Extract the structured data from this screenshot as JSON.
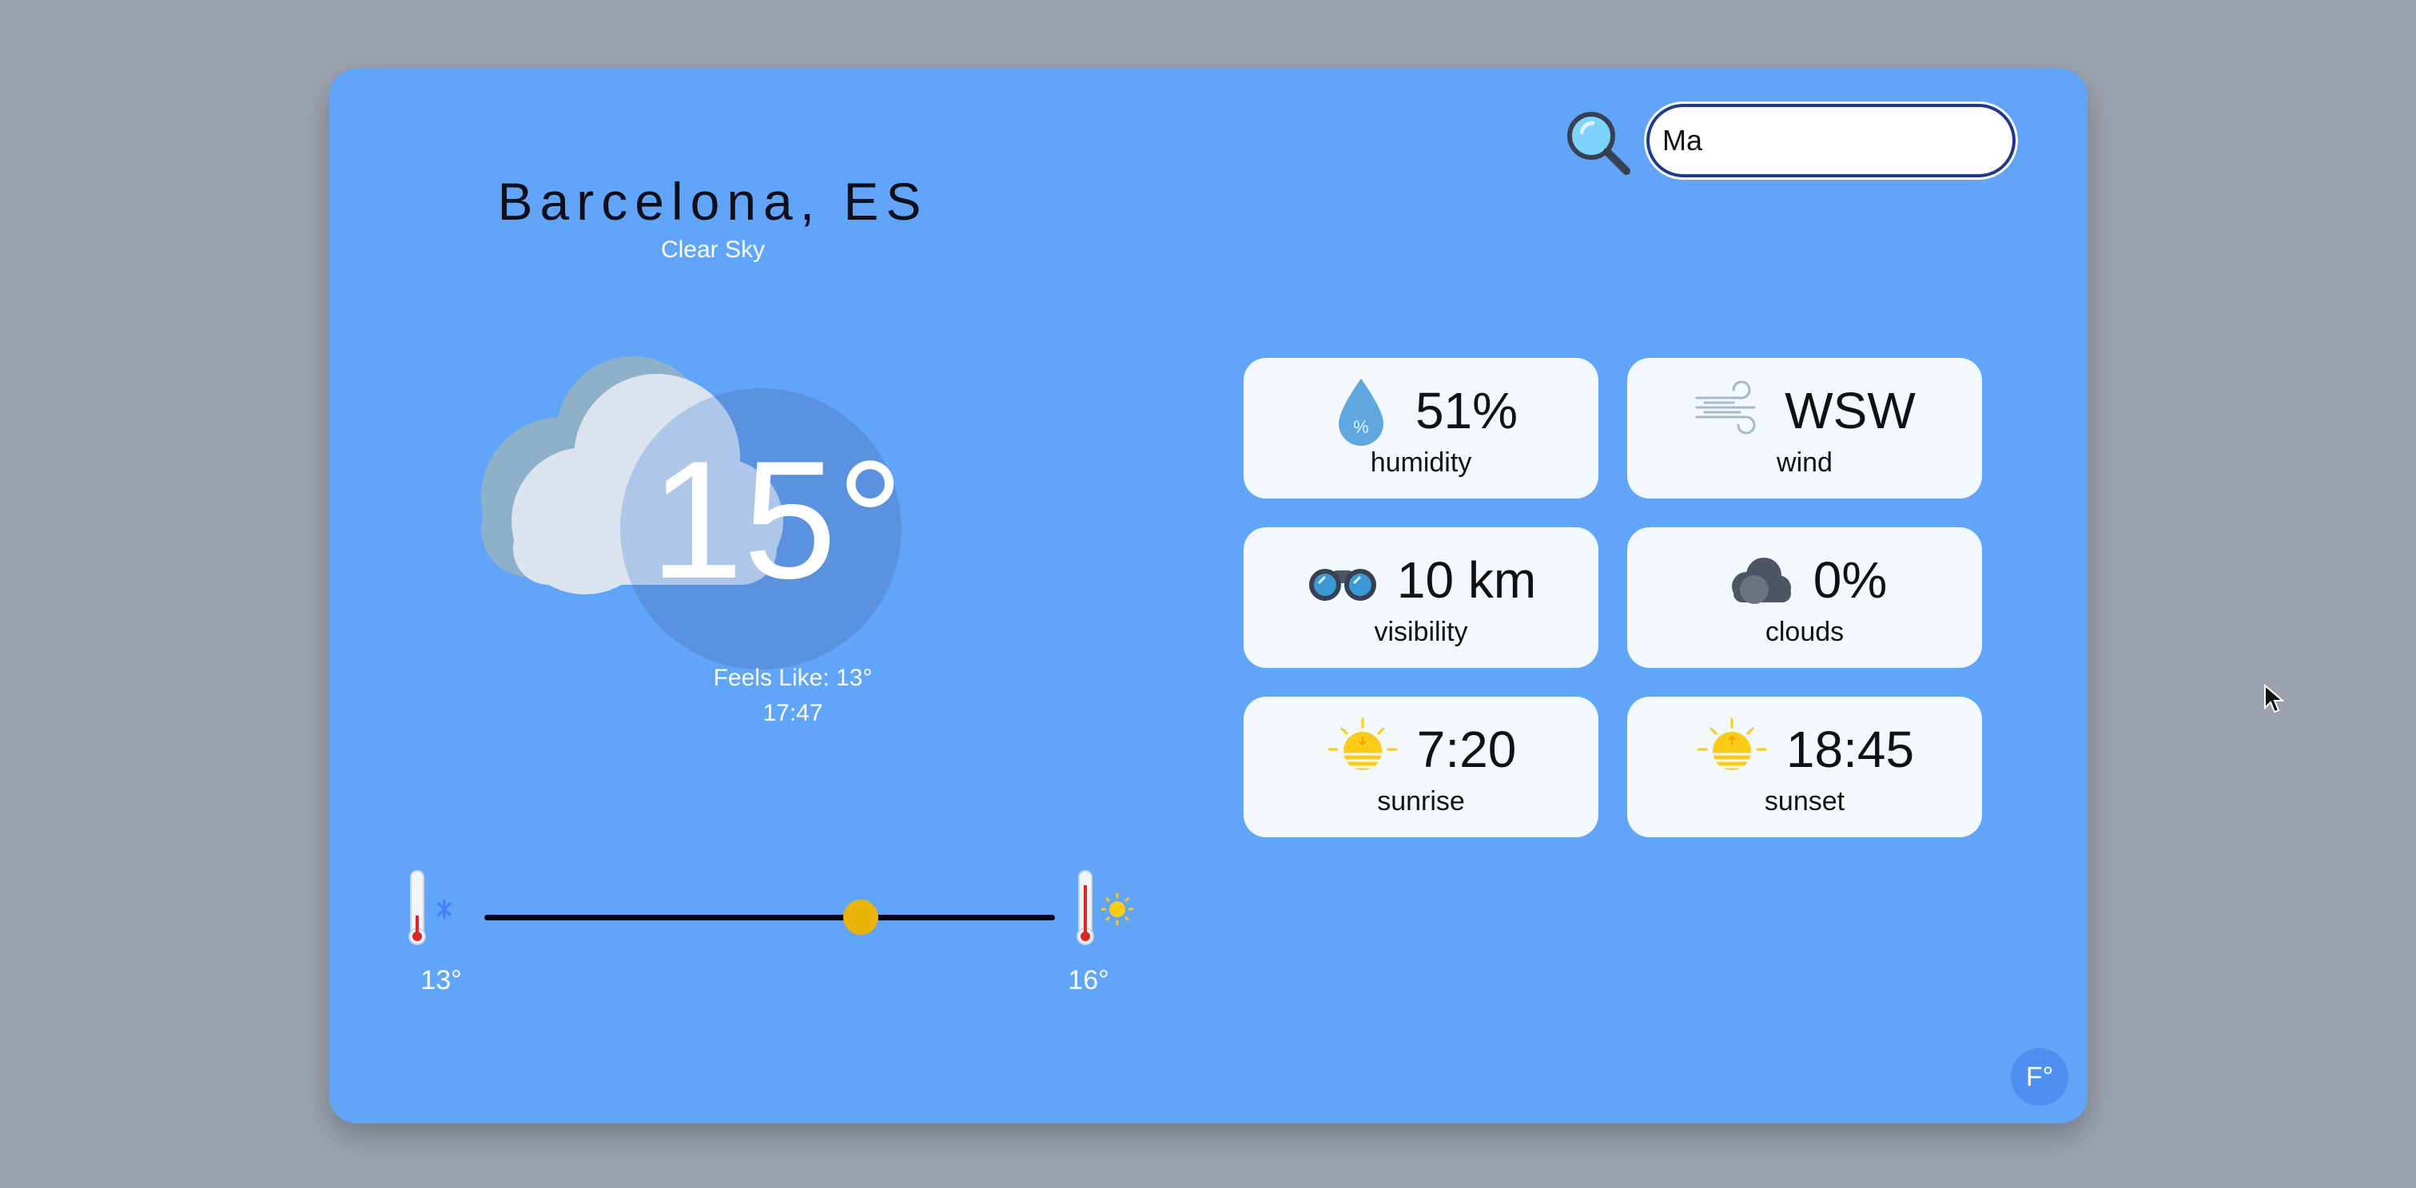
{
  "search": {
    "value": "Ma"
  },
  "location": {
    "city": "Barcelona, ES",
    "description": "Clear Sky"
  },
  "current": {
    "temp": "15°",
    "feels_like": "Feels Like: 13°",
    "time": "17:47",
    "icon": "cloud-sun-icon"
  },
  "range": {
    "min": "13°",
    "max": "16°",
    "current_fraction": 0.66
  },
  "stats": [
    {
      "value": "51%",
      "label": "humidity",
      "icon": "water-drop-icon"
    },
    {
      "value": "WSW",
      "label": "wind",
      "icon": "wind-icon"
    },
    {
      "value": "10 km",
      "label": "visibility",
      "icon": "binoculars-icon"
    },
    {
      "value": "0%",
      "label": "clouds",
      "icon": "cloud-icon"
    },
    {
      "value": "7:20",
      "label": "sunrise",
      "icon": "sunrise-icon"
    },
    {
      "value": "18:45",
      "label": "sunset",
      "icon": "sunset-icon"
    }
  ],
  "unit_toggle": {
    "label": "F°"
  },
  "colors": {
    "background": "#9ca3af",
    "card": "#60a5fa",
    "tile": "#f3f8fc",
    "accent": "#eab308"
  }
}
